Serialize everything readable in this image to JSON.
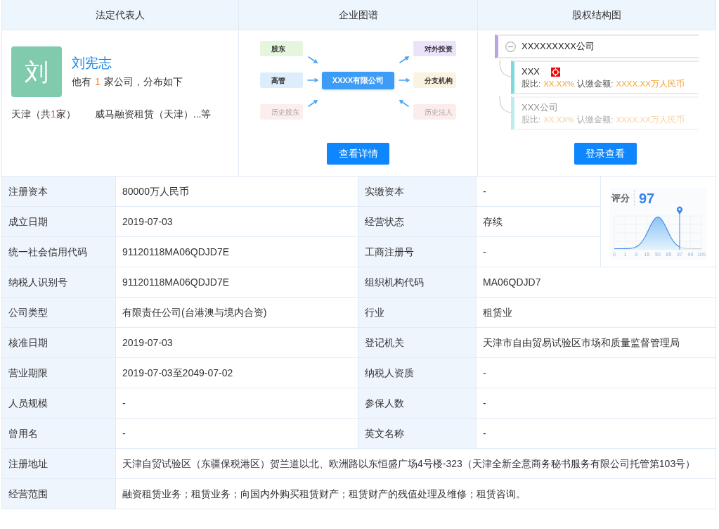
{
  "legal_representative": {
    "title": "法定代表人",
    "avatar": "刘",
    "name": "刘宪志",
    "summary": {
      "before": "他有",
      "count": "1",
      "after": "家公司，分布如下"
    },
    "regions": [
      {
        "before": "天津（共",
        "count": "1",
        "after": "家）",
        "companies": "威马融资租赁（天津）...等"
      }
    ]
  },
  "enterprise_graph": {
    "title": "企业图谱",
    "center": "XXXX有限公司",
    "left_nodes": [
      {
        "label": "股东",
        "kind": "inbound",
        "color": "#e5f5de",
        "dimmed": false
      },
      {
        "label": "高管",
        "kind": "inbound",
        "color": "#deedfc",
        "dimmed": false
      },
      {
        "label": "历史股东",
        "kind": "inbound",
        "color": "#fdeeee",
        "dimmed": true
      }
    ],
    "right_nodes": [
      {
        "label": "对外投资",
        "kind": "outbound",
        "color": "#ece3fb",
        "dimmed": false
      },
      {
        "label": "分支机构",
        "kind": "outbound",
        "color": "#fbf3df",
        "dimmed": false
      },
      {
        "label": "历史法人",
        "kind": "inbound",
        "color": "#fdecec",
        "dimmed": true
      }
    ],
    "button": "查看详情"
  },
  "equity_structure": {
    "title": "股权结构图",
    "root": {
      "name": "XXXXXXXXX公司",
      "expanded": true
    },
    "children": [
      {
        "name": "XXX",
        "flagged": true,
        "share_label": "股比:",
        "share": "XX.XX%",
        "amount_label": "认缴金额:",
        "amount": "XXXX.XX万人民币",
        "dimmed": false
      },
      {
        "name": "XXX公司",
        "flagged": false,
        "share_label": "股比:",
        "share": "XX.XX%",
        "amount_label": "认缴金额:",
        "amount": "XXXX.XX万人民币",
        "dimmed": true
      }
    ],
    "button": "登录查看"
  },
  "details": {
    "score": {
      "label": "评分",
      "value": "97",
      "axis": [
        {
          "label": "0",
          "marker": false
        },
        {
          "label": "1",
          "marker": false
        },
        {
          "label": "3",
          "marker": false
        },
        {
          "label": "15",
          "marker": false
        },
        {
          "label": "50",
          "marker": false
        },
        {
          "label": "85",
          "marker": false
        },
        {
          "label": "97",
          "marker": true
        },
        {
          "label": "99",
          "marker": false
        },
        {
          "label": "100",
          "marker": false
        }
      ]
    },
    "rows": [
      {
        "fields": [
          {
            "label": "注册资本",
            "value": "80000万人民币"
          },
          {
            "label": "实缴资本",
            "value": "-"
          }
        ]
      },
      {
        "fields": [
          {
            "label": "成立日期",
            "value": "2019-07-03"
          },
          {
            "label": "经营状态",
            "value": "存续"
          }
        ]
      },
      {
        "fields": [
          {
            "label": "统一社会信用代码",
            "value": "91120118MA06QDJD7E"
          },
          {
            "label": "工商注册号",
            "value": "-"
          }
        ]
      },
      {
        "fields": [
          {
            "label": "纳税人识别号",
            "value": "91120118MA06QDJD7E"
          },
          {
            "label": "组织机构代码",
            "value": "MA06QDJD7"
          }
        ]
      },
      {
        "fields": [
          {
            "label": "公司类型",
            "value": "有限责任公司(台港澳与境内合资)"
          },
          {
            "label": "行业",
            "value": "租赁业"
          }
        ]
      },
      {
        "fields": [
          {
            "label": "核准日期",
            "value": "2019-07-03"
          },
          {
            "label": "登记机关",
            "value": "天津市自由贸易试验区市场和质量监督管理局"
          }
        ]
      },
      {
        "fields": [
          {
            "label": "营业期限",
            "value": "2019-07-03至2049-07-02"
          },
          {
            "label": "纳税人资质",
            "value": "-"
          }
        ]
      },
      {
        "fields": [
          {
            "label": "人员规模",
            "value": "-"
          },
          {
            "label": "参保人数",
            "value": "-"
          }
        ]
      },
      {
        "fields": [
          {
            "label": "曾用名",
            "value": "-"
          },
          {
            "label": "英文名称",
            "value": "-"
          }
        ]
      },
      {
        "fields": [
          {
            "label": "注册地址",
            "value": "天津自贸试验区（东疆保税港区）贺兰道以北、欧洲路以东恒盛广场4号楼-323（天津全新全意商务秘书服务有限公司托管第103号）"
          }
        ]
      },
      {
        "fields": [
          {
            "label": "经营范围",
            "value": "融资租赁业务；租赁业务；向国内外购买租赁财产；租赁财产的残值处理及维修；租赁咨询。"
          }
        ]
      }
    ]
  }
}
